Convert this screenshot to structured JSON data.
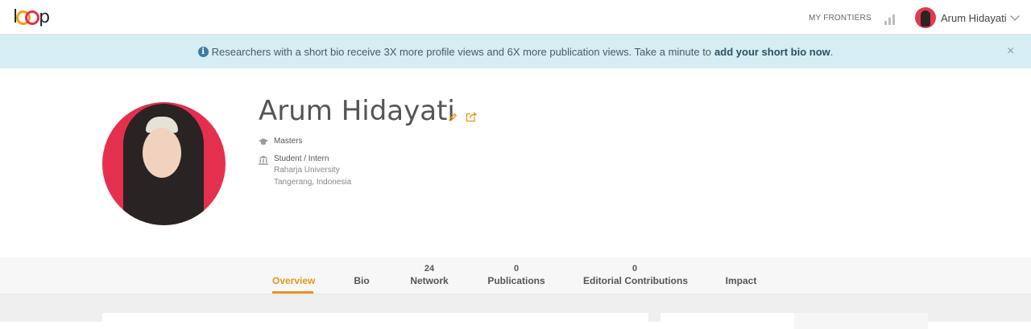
{
  "nav": {
    "logo_text": "loop",
    "my_frontiers": "MY FRONTIERS",
    "stats_icon": "bar-chart-icon",
    "user_name": "Arum Hidayati"
  },
  "banner": {
    "text": "Researchers with a short bio receive 3X more profile views and 6X more publication views. Take a minute to",
    "link": "add your short bio now",
    "end": ".",
    "close": "×"
  },
  "profile": {
    "name": "Arum Hidayati",
    "degree": "Masters",
    "position": "Student / Intern",
    "institution": "Raharja University",
    "location": "Tangerang, Indonesia"
  },
  "tabs": [
    {
      "label": "Overview",
      "count": ""
    },
    {
      "label": "Bio",
      "count": ""
    },
    {
      "label": "Network",
      "count": "24"
    },
    {
      "label": "Publications",
      "count": "0"
    },
    {
      "label": "Editorial Contributions",
      "count": "0"
    },
    {
      "label": "Impact",
      "count": ""
    }
  ],
  "colors": {
    "accent": "#e5961c",
    "banner_bg": "#d6edf3",
    "avatar_bg": "#e4304e"
  }
}
